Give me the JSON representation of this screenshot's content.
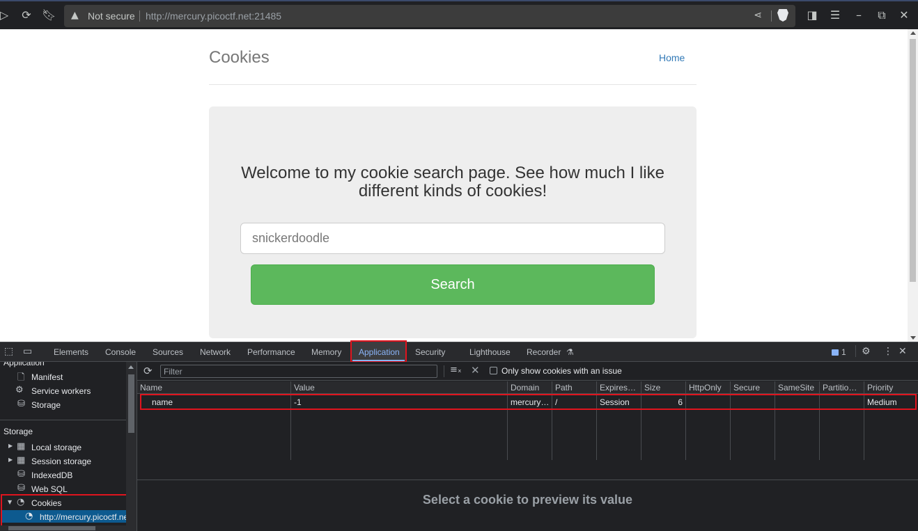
{
  "browser": {
    "security_label": "Not secure",
    "url_host": "http://mercury.picoctf.net",
    "url_port": ":21485"
  },
  "site": {
    "title": "Cookies",
    "nav_home": "Home",
    "welcome": "Welcome to my cookie search page. See how much I like different kinds of cookies!",
    "search_placeholder": "snickerdoodle",
    "search_button": "Search"
  },
  "devtools": {
    "tabs": [
      "Elements",
      "Console",
      "Sources",
      "Network",
      "Performance",
      "Memory",
      "Application",
      "Security",
      "Lighthouse",
      "Recorder"
    ],
    "active_tab": "Application",
    "issues_count": "1",
    "sidebar": {
      "application_header": "Application",
      "application_items": [
        "Manifest",
        "Service workers",
        "Storage"
      ],
      "storage_header": "Storage",
      "storage_items": [
        "Local storage",
        "Session storage",
        "IndexedDB",
        "Web SQL",
        "Cookies"
      ],
      "cookie_origin": "http://mercury.picoctf.net"
    },
    "cookies": {
      "filter_placeholder": "Filter",
      "only_issues_label": "Only show cookies with an issue",
      "columns": [
        "Name",
        "Value",
        "Domain",
        "Path",
        "Expires…",
        "Size",
        "HttpOnly",
        "Secure",
        "SameSite",
        "Partitio…",
        "Priority"
      ],
      "rows": [
        {
          "name": "name",
          "value": "-1",
          "domain": "mercury…",
          "path": "/",
          "expires": "Session",
          "size": "6",
          "httponly": "",
          "secure": "",
          "samesite": "",
          "partition": "",
          "priority": "Medium"
        }
      ],
      "preview_text": "Select a cookie to preview its value"
    }
  },
  "colors": {
    "highlight": "#e0141e",
    "search_button": "#5cb85c",
    "link": "#337ab7",
    "devtools_accent": "#8ab4f8"
  }
}
